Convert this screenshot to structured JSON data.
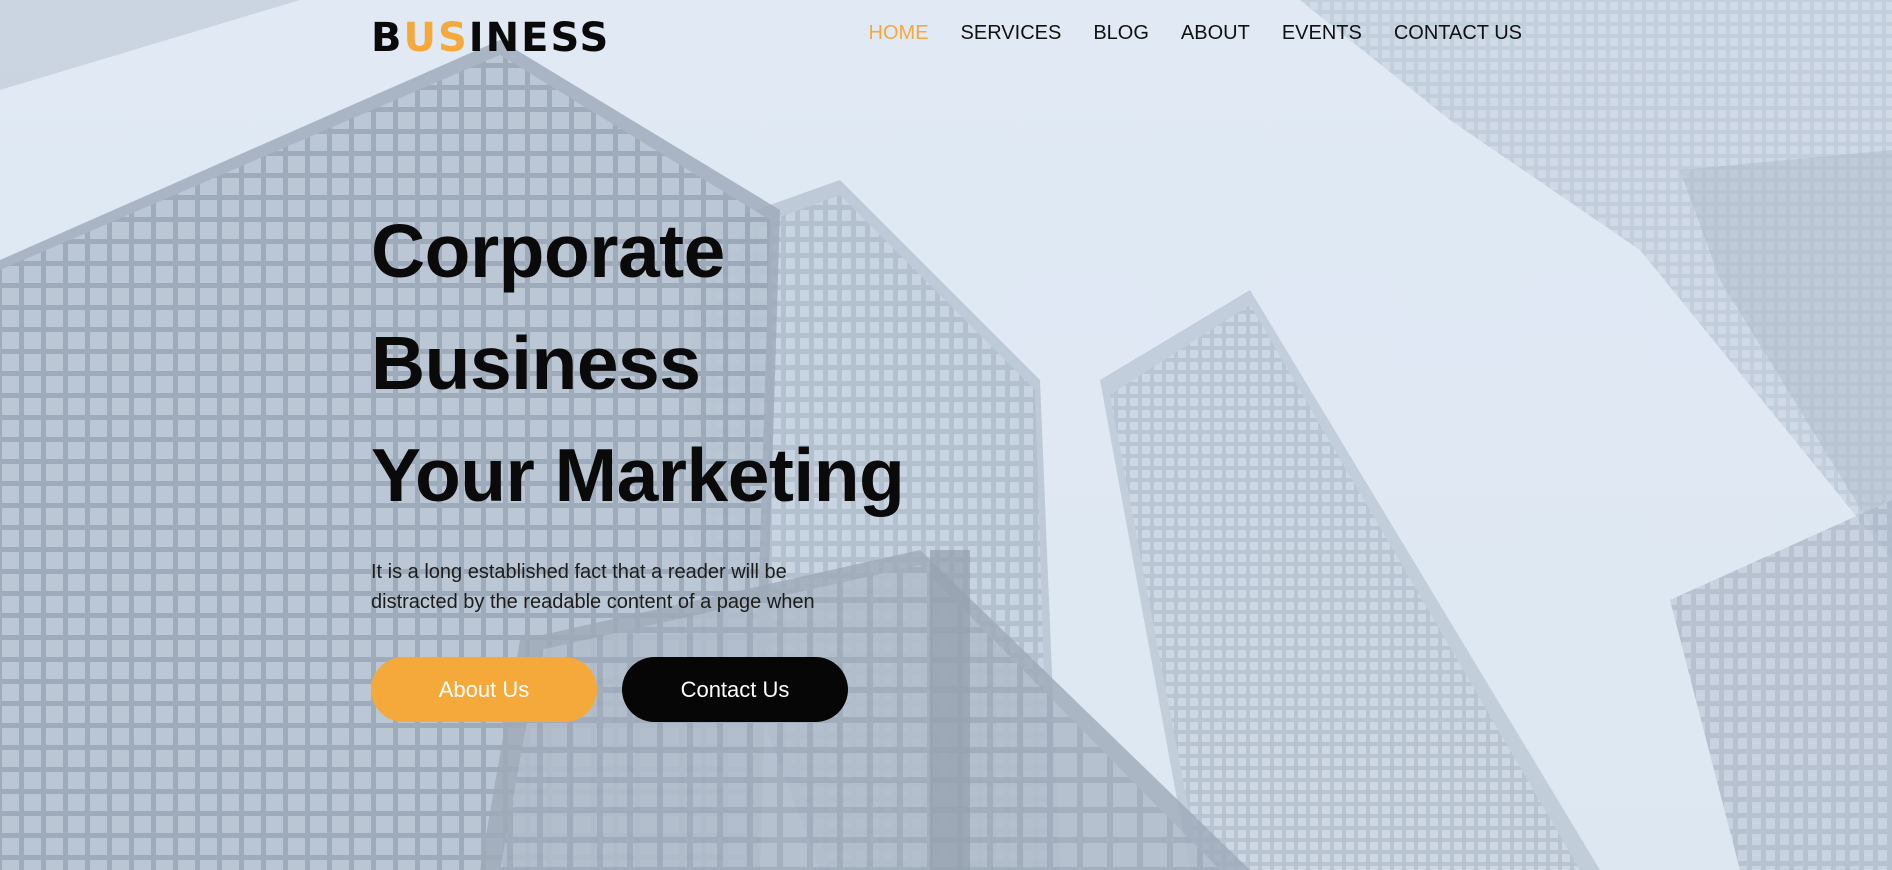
{
  "logo": {
    "part1": "B",
    "part2": "US",
    "part3": "INESS",
    "accent_color": "#f5a93b"
  },
  "nav": {
    "items": [
      {
        "label": "HOME",
        "active": true
      },
      {
        "label": "SERVICES",
        "active": false
      },
      {
        "label": "BLOG",
        "active": false
      },
      {
        "label": "ABOUT",
        "active": false
      },
      {
        "label": "EVENTS",
        "active": false
      },
      {
        "label": "CONTACT US",
        "active": false
      }
    ]
  },
  "hero": {
    "title_line1": "Corporate",
    "title_line2": "Business",
    "title_line3": "Your Marketing",
    "text": "It is a long established fact that a reader will be distracted by the readable content of a page when",
    "about_button": "About Us",
    "contact_button": "Contact Us"
  },
  "colors": {
    "accent": "#f5a93b",
    "dark": "#060606",
    "background": "#e1eaf4"
  }
}
